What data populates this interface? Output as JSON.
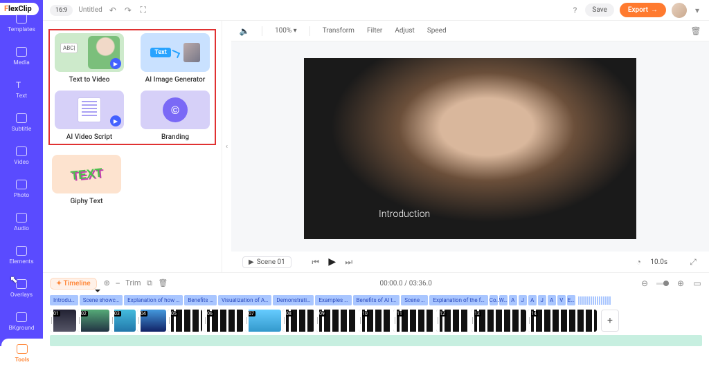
{
  "brand": {
    "prefix": "F",
    "rest": "lexClip"
  },
  "header": {
    "ratio": "16:9",
    "title": "Untitled",
    "save": "Save",
    "export": "Export"
  },
  "nav": {
    "items": [
      "Templates",
      "Media",
      "Text",
      "Subtitle",
      "Video",
      "Photo",
      "Audio",
      "Elements",
      "Overlays",
      "BKground"
    ],
    "tools": "Tools"
  },
  "tools_panel": {
    "cards": [
      {
        "label": "Text to Video"
      },
      {
        "label": "AI Image Generator",
        "chip": "Text"
      },
      {
        "label": "AI Video Script"
      },
      {
        "label": "Branding"
      }
    ],
    "solo": {
      "label": "Giphy Text",
      "art": "TEXT"
    }
  },
  "preview": {
    "zoom": "100%",
    "tabs": [
      "Transform",
      "Filter",
      "Adjust",
      "Speed"
    ],
    "caption": "Introduction",
    "scene": "Scene 01",
    "duration": "10.0s",
    "time": "00:00.0 / 03:36.0"
  },
  "timeline": {
    "label": "Timeline",
    "trim": "Trim",
    "tags": [
      "Introdu…",
      "Scene showc…",
      "Explanation of how …",
      "Benefits …",
      "Visualization of A…",
      "Demonstrati…",
      "Examples …",
      "Benefits of AI t…",
      "Scene …",
      "Explanation of the f…",
      "Co…",
      "W…",
      "A",
      "J",
      "A",
      "J",
      "A",
      "V",
      "E…"
    ],
    "clips": [
      "01",
      "02",
      "03",
      "04",
      "05",
      "06",
      "07",
      "08",
      "09",
      "10",
      "11",
      "12",
      "13",
      "14"
    ]
  }
}
